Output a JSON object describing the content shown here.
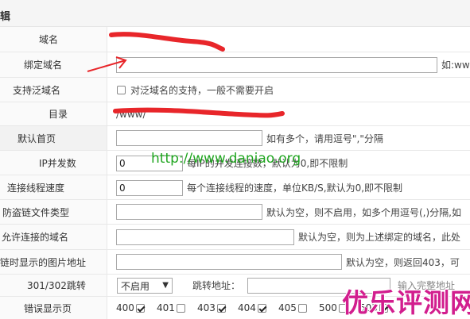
{
  "header": {
    "title": "辑"
  },
  "rows": {
    "domain": {
      "label": "域名",
      "value": ""
    },
    "bind_domain": {
      "label": "绑定域名",
      "value": "",
      "hint": "如:www"
    },
    "wildcard": {
      "label": "支持泛域名",
      "checkbox_label": "对泛域名的支持，一般不需要开启"
    },
    "directory": {
      "label": "目录",
      "value": "/www/"
    },
    "default_page": {
      "label": "默认首页",
      "value": "",
      "hint": "如有多个，请用逗号\",\"分隔"
    },
    "ip_concurrency": {
      "label": "IP并发数",
      "value": "0",
      "hint": "每IP的并发连接数，默认为0,即不限制"
    },
    "conn_speed": {
      "label": "连接线程速度",
      "value": "0",
      "hint": "每个连接线程的速度，单位KB/S,默认为0,即不限制"
    },
    "hotlink_types": {
      "label": "防盗链文件类型",
      "value": "",
      "hint": "默认为空，则不启用，如多个用逗号(,)分隔,如"
    },
    "allowed_domains": {
      "label": "允许连接的域名",
      "value": "",
      "hint": "默认为空，则为上述绑定的域名，此处"
    },
    "hotlink_image": {
      "label": "链时显示的图片地址",
      "value": "",
      "hint": "默认为空，则返回403，可"
    },
    "redirect": {
      "label": "301/302跳转",
      "select_value": "不启用",
      "target_label": "跳转地址：",
      "target_hint": "输入完整地址"
    },
    "error_pages": {
      "label": "错误显示页",
      "codes": [
        {
          "code": "400",
          "checked": true
        },
        {
          "code": "401",
          "checked": false
        },
        {
          "code": "403",
          "checked": true
        },
        {
          "code": "404",
          "checked": true
        },
        {
          "code": "405",
          "checked": false
        },
        {
          "code": "500",
          "checked": false
        },
        {
          "code": "503",
          "checked": true
        }
      ]
    }
  },
  "watermark": {
    "text": "http://www.daniao.org"
  },
  "logo": {
    "text": "优乐评测网"
  },
  "colors": {
    "watermark": "#1fa51f",
    "logo": "#d21e8e",
    "scribble": "#e8262a"
  },
  "icons": {
    "arrow": "red-arrow-icon",
    "checkbox": "checkbox-icon",
    "dropdown": "chevron-down-icon"
  }
}
